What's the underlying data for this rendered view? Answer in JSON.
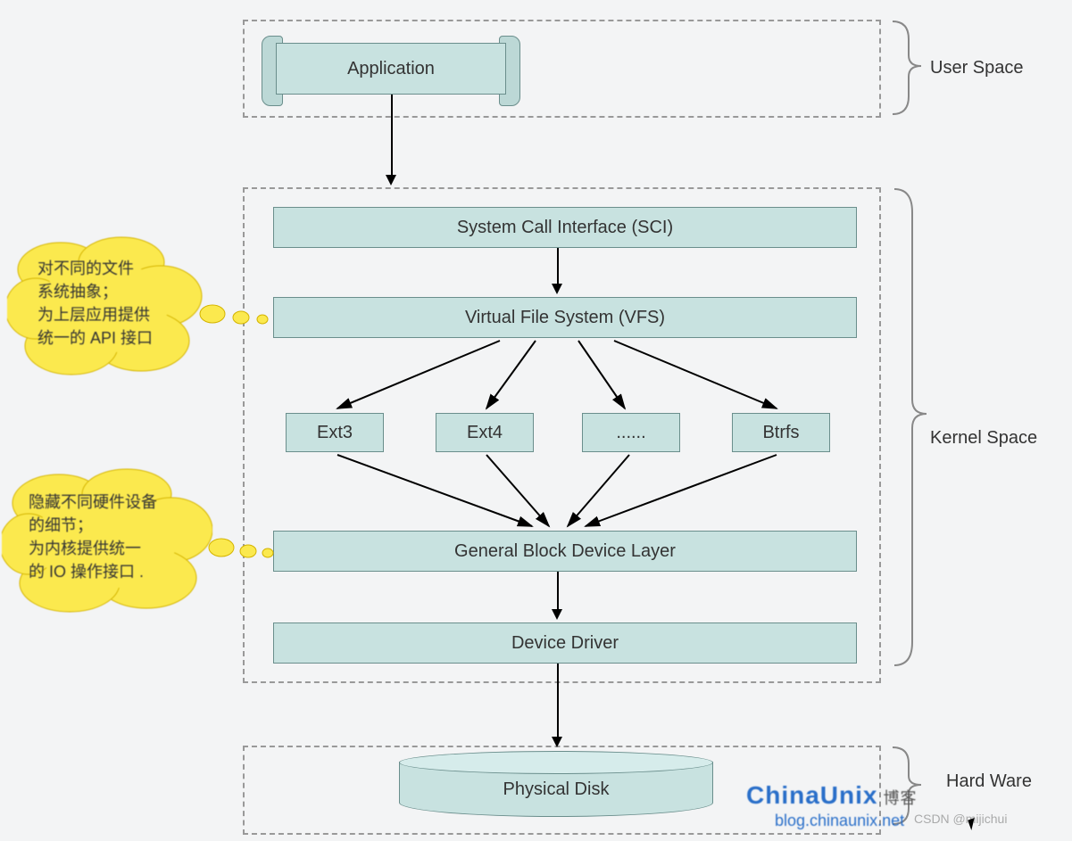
{
  "sections": {
    "user_space": "User Space",
    "kernel_space": "Kernel Space",
    "hardware": "Hard Ware"
  },
  "boxes": {
    "application": "Application",
    "sci": "System Call Interface (SCI)",
    "vfs": "Virtual File System (VFS)",
    "ext3": "Ext3",
    "ext4": "Ext4",
    "fsdots": "......",
    "btrfs": "Btrfs",
    "gbdl": "General Block Device Layer",
    "driver": "Device Driver",
    "disk": "Physical Disk"
  },
  "clouds": {
    "vfs_note_l1": "对不同的文件",
    "vfs_note_l2": "系统抽象；",
    "vfs_note_l3": "为上层应用提供",
    "vfs_note_l4": "统一的 API 接口",
    "gbdl_note_l1": "隐藏不同硬件设备",
    "gbdl_note_l2": "的细节；",
    "gbdl_note_l3": "为内核提供统一",
    "gbdl_note_l4": "的 IO 操作接口 ."
  },
  "logo": {
    "main": "ChinaUnix",
    "suffix": "博客",
    "sub": "blog.chinaunix.net"
  },
  "watermark": "CSDN @mijichui"
}
